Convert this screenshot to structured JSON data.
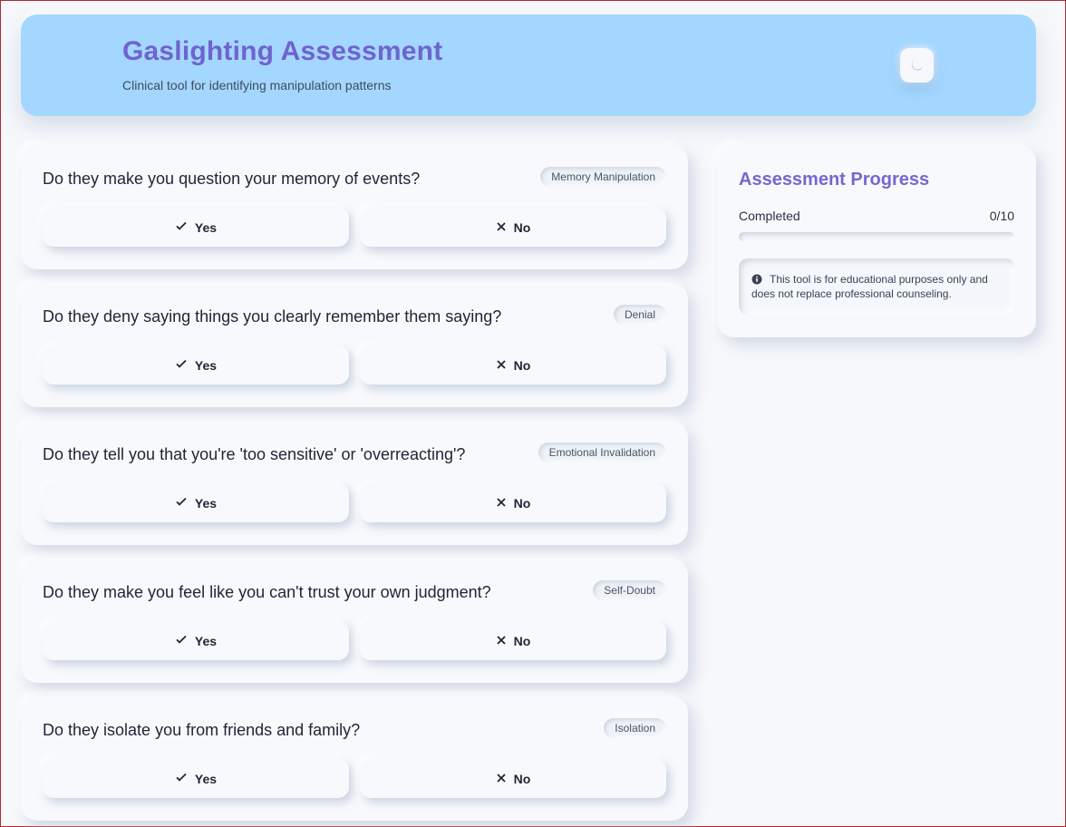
{
  "header": {
    "title": "Gaslighting Assessment",
    "subtitle": "Clinical tool for identifying manipulation patterns",
    "theme_toggle_icon": "moon-icon"
  },
  "colors": {
    "header_bg": "#a3d7ff",
    "title": "#6f63cf",
    "accent": "#7667d0",
    "page_bg": "#f6f8fb"
  },
  "questions": [
    {
      "text": "Do they make you question your memory of events?",
      "tag": "Memory Manipulation",
      "yes_label": "Yes",
      "no_label": "No"
    },
    {
      "text": "Do they deny saying things you clearly remember them saying?",
      "tag": "Denial",
      "yes_label": "Yes",
      "no_label": "No"
    },
    {
      "text": "Do they tell you that you're 'too sensitive' or 'overreacting'?",
      "tag": "Emotional Invalidation",
      "yes_label": "Yes",
      "no_label": "No"
    },
    {
      "text": "Do they make you feel like you can't trust your own judgment?",
      "tag": "Self-Doubt",
      "yes_label": "Yes",
      "no_label": "No"
    },
    {
      "text": "Do they isolate you from friends and family?",
      "tag": "Isolation",
      "yes_label": "Yes",
      "no_label": "No"
    }
  ],
  "progress": {
    "title": "Assessment Progress",
    "completed_label": "Completed",
    "completed_count": "0/10",
    "fraction_complete": 0,
    "note": "This tool is for educational purposes only and does not replace professional counseling.",
    "note_icon": "info-icon"
  }
}
